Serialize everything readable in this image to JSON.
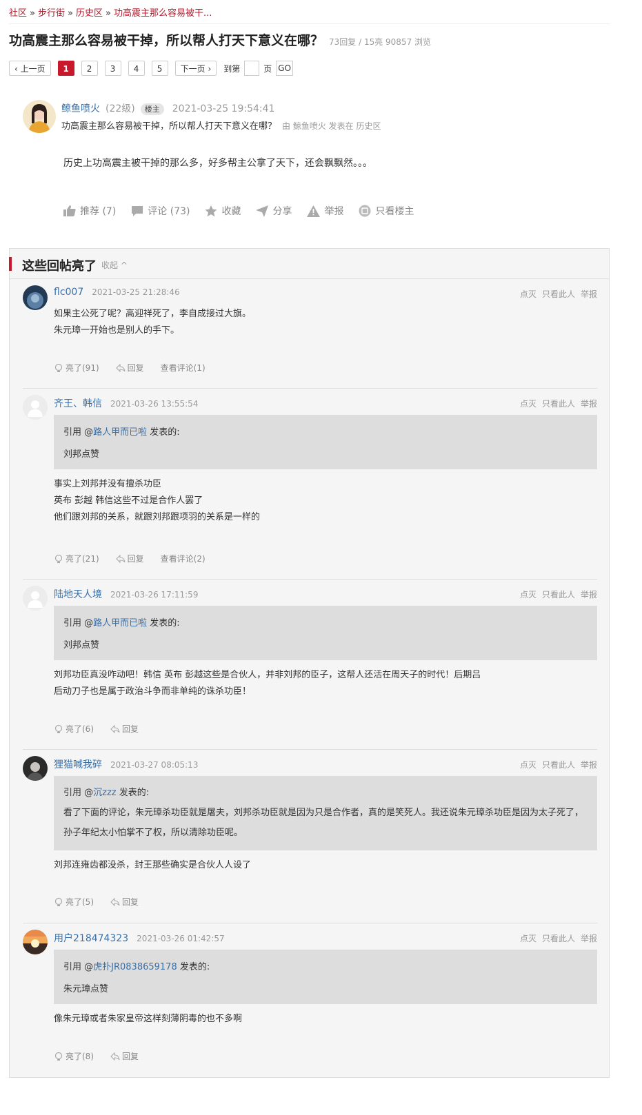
{
  "breadcrumb": {
    "items": [
      "社区",
      "步行街",
      "历史区",
      "功高震主那么容易被干..."
    ],
    "sep": "»"
  },
  "thread": {
    "title": "功高震主那么容易被干掉，所以帮人打天下意义在哪？",
    "stats": "73回复 / 15亮 90857 浏览"
  },
  "pager": {
    "prev": "‹ 上一页",
    "pages": [
      "1",
      "2",
      "3",
      "4",
      "5"
    ],
    "next": "下一页 ›",
    "goto_label": "到第",
    "page_label": "页",
    "go": "GO"
  },
  "op": {
    "username": "鲸鱼喷火",
    "level": "(22级)",
    "badge": "楼主",
    "time": "2021-03-25 19:54:41",
    "subtitle": "功高震主那么容易被干掉，所以帮人打天下意义在哪？",
    "by_text": "由  鲸鱼喷火 发表在  历史区",
    "body": "历史上功高震主被干掉的那么多，好多帮主公拿了天下，还会飘飘然。。。",
    "actions": {
      "recommend": "推荐 (7)",
      "comment": "评论 (73)",
      "favorite": "收藏",
      "share": "分享",
      "report": "举报",
      "only_op": "只看楼主"
    }
  },
  "lit": {
    "title": "这些回帖亮了",
    "collapse": "收起 ^"
  },
  "reply_ops": {
    "dim": "点灭",
    "only": "只看此人",
    "report": "举报"
  },
  "replies": [
    {
      "user": "flc007",
      "time": "2021-03-25 21:28:46",
      "body": [
        "如果主公死了呢？高迎祥死了，李自成接过大旗。",
        "朱元璋一开始也是别人的手下。"
      ],
      "light": "亮了(91)",
      "reply": "回复",
      "view_comments": "查看评论(1)"
    },
    {
      "user": "齐王、韩信",
      "time": "2021-03-26 13:55:54",
      "quote_prefix": "引用 @",
      "quote_user": "路人甲而已啦",
      "quote_suffix": " 发表的:",
      "quote_text": "刘邦点赞",
      "body": [
        "事实上刘邦并没有擅杀功臣",
        "英布 彭越 韩信这些不过是合作人罢了",
        "他们跟刘邦的关系，就跟刘邦跟项羽的关系是一样的"
      ],
      "light": "亮了(21)",
      "reply": "回复",
      "view_comments": "查看评论(2)"
    },
    {
      "user": "陆地天人境",
      "time": "2021-03-26 17:11:59",
      "quote_prefix": "引用 @",
      "quote_user": "路人甲而已啦",
      "quote_suffix": " 发表的:",
      "quote_text": "刘邦点赞",
      "body": [
        "刘邦功臣真没咋动吧！韩信 英布 彭越这些是合伙人，并非刘邦的臣子，这帮人还活在周天子的时代！后期吕",
        "后动刀子也是属于政治斗争而非单纯的诛杀功臣！"
      ],
      "light": "亮了(6)",
      "reply": "回复"
    },
    {
      "user": "狸猫喊我碎",
      "time": "2021-03-27 08:05:13",
      "quote_prefix": "引用 @",
      "quote_user": "沉zzz",
      "quote_suffix": " 发表的:",
      "quote_text": "看了下面的评论，朱元璋杀功臣就是屠夫，刘邦杀功臣就是因为只是合作者，真的是笑死人。我还说朱元璋杀功臣是因为太子死了，孙子年纪太小怕掌不了权，所以清除功臣呢。",
      "body": [
        "刘邦连雍齿都没杀，封王那些确实是合伙人人设了"
      ],
      "light": "亮了(5)",
      "reply": "回复"
    },
    {
      "user": "用户218474323",
      "time": "2021-03-26 01:42:57",
      "quote_prefix": "引用 @",
      "quote_user": "虎扑JR0838659178",
      "quote_suffix": " 发表的:",
      "quote_text": "朱元璋点赞",
      "body": [
        "像朱元璋或者朱家皇帝这样刻薄阴毒的也不多啊"
      ],
      "light": "亮了(8)",
      "reply": "回复"
    }
  ]
}
